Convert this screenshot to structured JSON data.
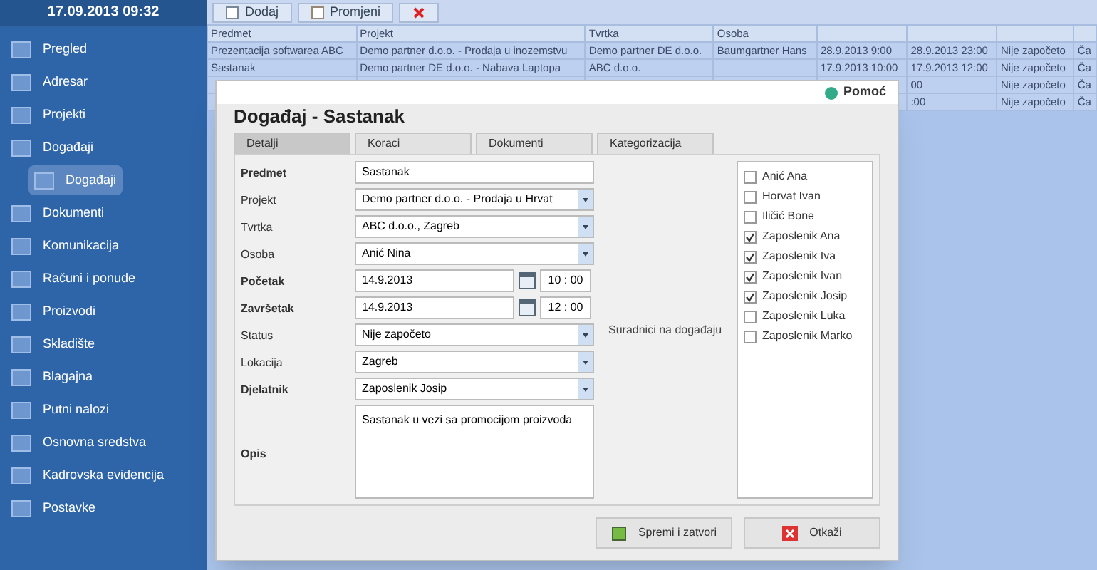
{
  "sidebar": {
    "datetime": "17.09.2013 09:32",
    "items": [
      {
        "label": "Pregled",
        "selected": false
      },
      {
        "label": "Adresar",
        "selected": false
      },
      {
        "label": "Projekti",
        "selected": false
      },
      {
        "label": "Događaji",
        "selected": false,
        "children": [
          {
            "label": "Događaji",
            "selected": true
          }
        ]
      },
      {
        "label": "Dokumenti",
        "selected": false
      },
      {
        "label": "Komunikacija",
        "selected": false
      },
      {
        "label": "Računi i ponude",
        "selected": false
      },
      {
        "label": "Proizvodi",
        "selected": false
      },
      {
        "label": "Skladište",
        "selected": false
      },
      {
        "label": "Blagajna",
        "selected": false
      },
      {
        "label": "Putni nalozi",
        "selected": false
      },
      {
        "label": "Osnovna sredstva",
        "selected": false
      },
      {
        "label": "Kadrovska evidencija",
        "selected": false
      },
      {
        "label": "Postavke",
        "selected": false
      }
    ]
  },
  "toolbar": [
    {
      "kind": "add",
      "label": "Dodaj"
    },
    {
      "kind": "edit",
      "label": "Promjeni"
    },
    {
      "kind": "delete"
    }
  ],
  "table": {
    "columns": [
      "Predmet",
      "Projekt",
      "Tvrtka",
      "Osoba"
    ],
    "rows": [
      {
        "cells": [
          "Prezentacija softwarea ABC",
          "Demo partner d.o.o. - Prodaja u inozemstvu",
          "Demo partner DE d.o.o.",
          "Baumgartner Hans",
          "28.9.2013 9:00",
          "28.9.2013 23:00",
          "Nije započeto",
          "Ča"
        ]
      },
      {
        "cells": [
          "Sastanak",
          "Demo partner DE d.o.o. - Nabava Laptopa",
          "ABC d.o.o.",
          "",
          "17.9.2013 10:00",
          "17.9.2013 12:00",
          "Nije započeto",
          "Ča"
        ]
      },
      {
        "end_cells": [
          "00",
          "Nije započeto",
          "Ča"
        ]
      },
      {
        "end_cells": [
          ":00",
          "Nije započeto",
          "Ča"
        ]
      }
    ]
  },
  "dialog": {
    "help": "Pomoć",
    "title": "Događaj - Sastanak",
    "tabs": [
      {
        "label": "Detalji",
        "selected": true
      },
      {
        "label": "Koraci",
        "selected": false
      },
      {
        "label": "Dokumenti",
        "selected": false
      },
      {
        "label": "Kategorizacija",
        "selected": false
      }
    ],
    "fields": [
      {
        "kind": "text",
        "label": "Predmet",
        "bold": true,
        "value": "Sastanak"
      },
      {
        "kind": "select",
        "label": "Projekt",
        "bold": false,
        "value": "Demo partner d.o.o. - Prodaja u Hrvat"
      },
      {
        "kind": "select",
        "label": "Tvrtka",
        "bold": false,
        "value": "ABC d.o.o., Zagreb"
      },
      {
        "kind": "select",
        "label": "Osoba",
        "bold": false,
        "value": "Anić Nina"
      },
      {
        "kind": "datetime",
        "label": "Početak",
        "bold": true,
        "value": "14.9.2013",
        "time": "10 : 00"
      },
      {
        "kind": "datetime",
        "label": "Završetak",
        "bold": true,
        "value": "14.9.2013",
        "time": "12 : 00"
      },
      {
        "kind": "select",
        "label": "Status",
        "bold": false,
        "value": "Nije započeto"
      },
      {
        "kind": "select",
        "label": "Lokacija",
        "bold": false,
        "value": "Zagreb"
      },
      {
        "kind": "select",
        "label": "Djelatnik",
        "bold": true,
        "value": "Zaposlenik Josip"
      },
      {
        "kind": "textarea",
        "label": "Opis",
        "bold": true,
        "value": "Sastanak u vezi sa promocijom proizvoda"
      }
    ],
    "collaborators_label": "Suradnici na događaju",
    "collaborators": [
      {
        "label": "Anić Ana",
        "checked": false
      },
      {
        "label": "Horvat Ivan",
        "checked": false
      },
      {
        "label": "Iličić Bone",
        "checked": false
      },
      {
        "label": "Zaposlenik Ana",
        "checked": true
      },
      {
        "label": "Zaposlenik Iva",
        "checked": true
      },
      {
        "label": "Zaposlenik Ivan",
        "checked": true
      },
      {
        "label": "Zaposlenik Josip",
        "checked": true
      },
      {
        "label": "Zaposlenik Luka",
        "checked": false
      },
      {
        "label": "Zaposlenik Marko",
        "checked": false
      }
    ],
    "buttons": [
      {
        "kind": "save",
        "label": "Spremi i zatvori"
      },
      {
        "kind": "cancel",
        "label": "Otkaži"
      }
    ]
  }
}
